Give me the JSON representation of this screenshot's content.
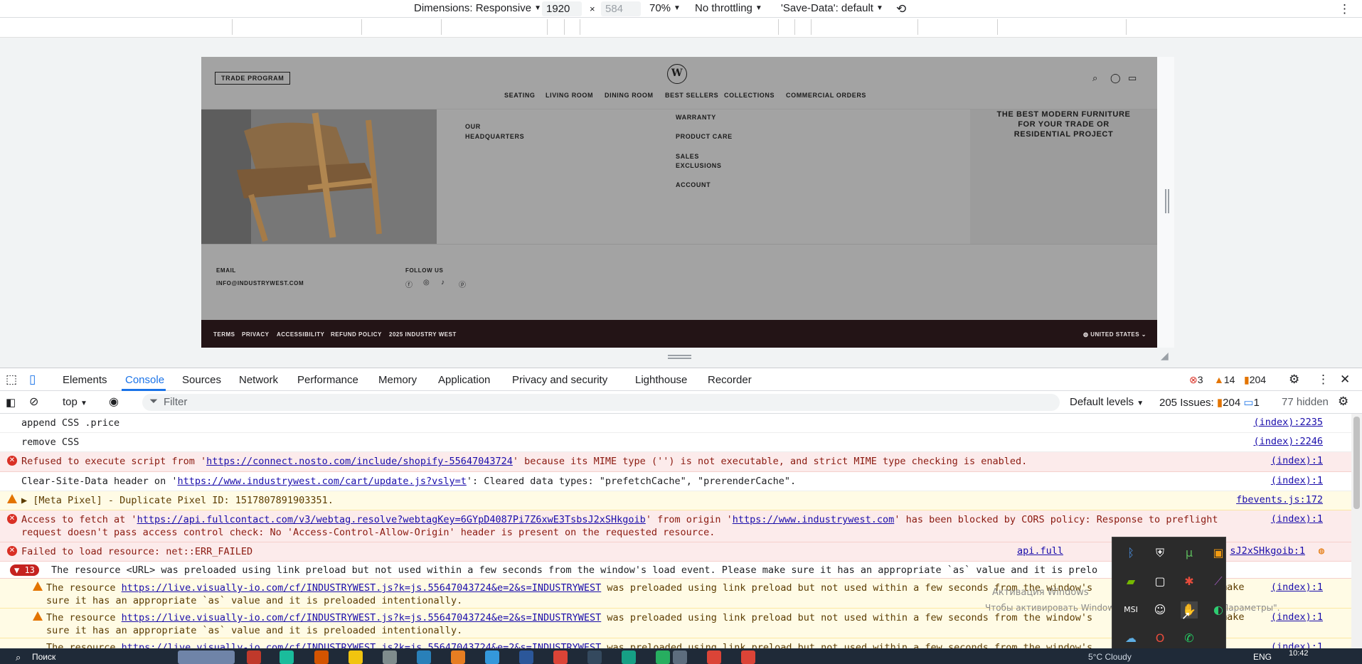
{
  "device_toolbar": {
    "dimensions_label": "Dimensions: Responsive",
    "width_value": "1920",
    "times": "×",
    "height_placeholder": "584",
    "zoom": "70%",
    "throttling": "No throttling",
    "save_data": "'Save-Data': default"
  },
  "site": {
    "trade_program": "TRADE PROGRAM",
    "logo": "W",
    "nav": [
      "SEATING",
      "LIVING ROOM",
      "DINING ROOM",
      "BEST SELLERS",
      "COLLECTIONS",
      "COMMERCIAL ORDERS"
    ],
    "links_col1": [
      "OUR",
      "HEADQUARTERS"
    ],
    "links_col2": [
      "WARRANTY",
      "PRODUCT CARE",
      "SALES",
      "EXCLUSIONS",
      "ACCOUNT"
    ],
    "promo": [
      "THE BEST MODERN FURNITURE",
      "FOR YOUR TRADE OR",
      "RESIDENTIAL PROJECT"
    ],
    "email_label": "EMAIL",
    "email_value": "INFO@INDUSTRYWEST.COM",
    "follow_label": "FOLLOW US",
    "bottom_links": [
      "TERMS",
      "PRIVACY",
      "ACCESSIBILITY",
      "REFUND POLICY",
      "2025 INDUSTRY WEST"
    ],
    "country": "UNITED STATES"
  },
  "devtools": {
    "tabs": [
      "Elements",
      "Console",
      "Sources",
      "Network",
      "Performance",
      "Memory",
      "Application",
      "Privacy and security",
      "Lighthouse",
      "Recorder"
    ],
    "counts": {
      "errors": "3",
      "warnings": "14",
      "info": "204"
    },
    "context": "top",
    "filter_placeholder": "Filter",
    "levels": "Default levels",
    "issues_label": "205 Issues:",
    "issues_warn": "204",
    "issues_info": "1",
    "hidden": "77 hidden"
  },
  "console": [
    {
      "type": "log",
      "text": "append CSS .price",
      "source": "(index):2235"
    },
    {
      "type": "log",
      "text": "remove CSS",
      "source": "(index):2246"
    },
    {
      "type": "error",
      "pre": "Refused to execute script from '",
      "link": "https://connect.nosto.com/include/shopify-55647043724",
      "post": "' because its MIME type ('') is not executable, and strict MIME type checking is enabled.",
      "source": "(index):1"
    },
    {
      "type": "log",
      "pre": "Clear-Site-Data header on '",
      "link": "https://www.industrywest.com/cart/update.js?vsly=t",
      "post": "': Cleared data types: \"prefetchCache\", \"prerenderCache\".",
      "source": "(index):1"
    },
    {
      "type": "warn",
      "text": "▶ [Meta Pixel] - Duplicate Pixel ID: 1517807891903351.",
      "source": "fbevents.js:172"
    },
    {
      "type": "error",
      "pre": "Access to fetch at '",
      "link": "https://api.fullcontact.com/v3/webtag.resolve?webtagKey=6GYpD4087Pi7Z6xwE3TsbsJ2xSHkgoib",
      "mid": "' from origin '",
      "link2": "https://www.industrywest.com",
      "post": "' has been blocked by CORS policy: Response to preflight",
      "line2": "request doesn't pass access control check: No 'Access-Control-Allow-Origin' header is present on the requested resource.",
      "source": "(index):1"
    },
    {
      "type": "error",
      "text": "Failed to load resource: net::ERR_FAILED",
      "source": "api.full",
      "source_tail": "sJ2xSHkgoib:1"
    },
    {
      "type": "error-group",
      "count": "▼ 13",
      "text": "The resource <URL> was preloaded using link preload but not used within a few seconds from the window's load event. Please make sure it has an appropriate `as` value and it is prelo"
    },
    {
      "type": "warn",
      "pre": "The resource ",
      "link": "https://live.visually-io.com/cf/INDUSTRYWEST.js?k=js.55647043724&e=2&s=INDUSTRYWEST",
      "post": " was preloaded using link preload but not used within a few seconds from the window's",
      "tail": "make",
      "line2": "sure it has an appropriate `as` value and it is preloaded intentionally.",
      "source": "(index):1"
    },
    {
      "type": "warn",
      "pre": "The resource ",
      "link": "https://live.visually-io.com/cf/INDUSTRYWEST.js?k=js.55647043724&e=2&s=INDUSTRYWEST",
      "post": " was preloaded using link preload but not used within a few seconds from the window's",
      "tail": "make",
      "line2": "sure it has an appropriate `as` value and it is preloaded intentionally.",
      "source": "(index):1"
    },
    {
      "type": "warn",
      "pre": "The resource ",
      "link": "https://live.visually-io.com/cf/INDUSTRYWEST.js?k=js.55647043724&e=2&s=INDUSTRYWEST",
      "post": " was preloaded using link preload but not used within a few seconds from the window's",
      "source": "(index):1"
    }
  ],
  "watermark": {
    "line1": "Активация Windows",
    "line2": "Чтобы активировать Windows, перейдите в раздел \"Параметры\"."
  },
  "taskbar": {
    "search": "Поиск",
    "weather": "5°C  Cloudy",
    "lang": "ENG",
    "time": "10:42"
  },
  "colors": {
    "accent": "#1a73e8",
    "error": "#d93025",
    "warning": "#e37400",
    "site_footer": "#231416"
  }
}
